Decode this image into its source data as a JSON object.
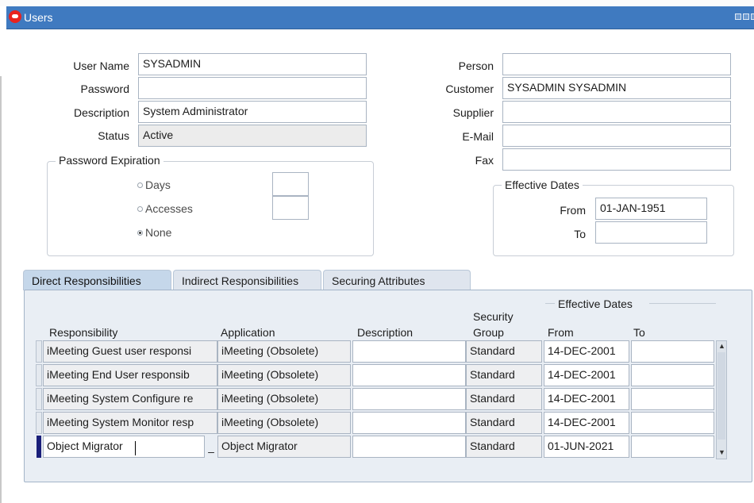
{
  "window": {
    "title": "Users"
  },
  "form": {
    "user_name": {
      "label": "User Name",
      "value": "SYSADMIN"
    },
    "password": {
      "label": "Password",
      "value": ""
    },
    "description": {
      "label": "Description",
      "value": "System Administrator"
    },
    "status": {
      "label": "Status",
      "value": "Active"
    },
    "person": {
      "label": "Person",
      "value": ""
    },
    "customer": {
      "label": "Customer",
      "value": "SYSADMIN SYSADMIN"
    },
    "supplier": {
      "label": "Supplier",
      "value": ""
    },
    "email": {
      "label": "E-Mail",
      "value": ""
    },
    "fax": {
      "label": "Fax",
      "value": ""
    }
  },
  "password_expiration": {
    "title": "Password Expiration",
    "options": [
      {
        "label": "Days",
        "checked": false
      },
      {
        "label": "Accesses",
        "checked": false
      },
      {
        "label": "None",
        "checked": true
      }
    ]
  },
  "effective_dates": {
    "title": "Effective Dates",
    "from_label": "From",
    "from_value": "01-JAN-1951",
    "to_label": "To",
    "to_value": ""
  },
  "tabs": [
    {
      "label": "Direct Responsibilities",
      "active": true
    },
    {
      "label": "Indirect Responsibilities",
      "active": false
    },
    {
      "label": "Securing Attributes",
      "active": false
    }
  ],
  "grid": {
    "headers": {
      "responsibility": "Responsibility",
      "application": "Application",
      "description": "Description",
      "security": "Security",
      "group": "Group",
      "effective_dates": "Effective Dates",
      "from": "From",
      "to": "To"
    },
    "rows": [
      {
        "responsibility": "iMeeting Guest user responsi",
        "application": "iMeeting (Obsolete)",
        "description": "",
        "group": "Standard",
        "from": "14-DEC-2001",
        "to": ""
      },
      {
        "responsibility": "iMeeting End User responsib",
        "application": "iMeeting (Obsolete)",
        "description": "",
        "group": "Standard",
        "from": "14-DEC-2001",
        "to": ""
      },
      {
        "responsibility": "iMeeting System Configure re",
        "application": "iMeeting (Obsolete)",
        "description": "",
        "group": "Standard",
        "from": "14-DEC-2001",
        "to": ""
      },
      {
        "responsibility": "iMeeting System Monitor resp",
        "application": "iMeeting (Obsolete)",
        "description": "",
        "group": "Standard",
        "from": "14-DEC-2001",
        "to": ""
      },
      {
        "responsibility": "Object Migrator",
        "application": "Object Migrator",
        "description": "",
        "group": "Standard",
        "from": "01-JUN-2021",
        "to": "",
        "current": true
      }
    ],
    "lov_indicator": "–"
  },
  "colors": {
    "titlebar": "#3f7ac0",
    "active_field": "#fff3a8",
    "tab_panel": "#e9eef4"
  },
  "icons": [
    "app-icon",
    "minimize-icon",
    "maximize-icon",
    "close-icon"
  ]
}
